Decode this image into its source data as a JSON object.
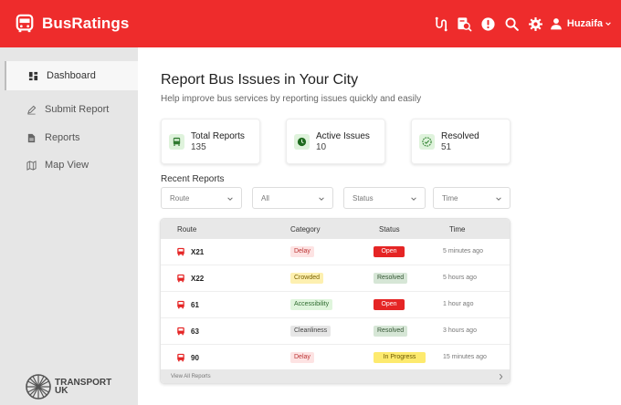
{
  "app": {
    "name": "BusRatings"
  },
  "header": {
    "user_name": "Huzaifa"
  },
  "sidebar": {
    "items": [
      {
        "label": "Dashboard",
        "active": true
      },
      {
        "label": "Submit Report",
        "active": false
      },
      {
        "label": "Reports",
        "active": false
      },
      {
        "label": "Map View",
        "active": false
      }
    ],
    "logo_text": [
      "TRANSPORT",
      "UK"
    ]
  },
  "main": {
    "title": "Report Bus Issues in Your City",
    "subtitle": "Help improve bus services by reporting issues quickly and easily",
    "stats": [
      {
        "label": "Total Reports",
        "value": "135",
        "icon": "bus-icon"
      },
      {
        "label": "Active Issues",
        "value": "10",
        "icon": "clock-icon"
      },
      {
        "label": "Resolved",
        "value": "51",
        "icon": "verified-icon"
      }
    ],
    "recent_title": "Recent Reports",
    "filters": [
      {
        "label": "Route"
      },
      {
        "label": "All"
      },
      {
        "label": "Status"
      },
      {
        "label": "Time"
      }
    ],
    "table": {
      "columns": [
        "Route",
        "Category",
        "Status",
        "Time"
      ],
      "rows": [
        {
          "route": "X21",
          "category": "Delay",
          "status": "Open",
          "time": "5 minutes ago"
        },
        {
          "route": "X22",
          "category": "Crowded",
          "status": "Resolved",
          "time": "5 hours ago"
        },
        {
          "route": "61",
          "category": "Accessibility",
          "status": "Open",
          "time": "1 hour ago"
        },
        {
          "route": "63",
          "category": "Cleanliness",
          "status": "Resolved",
          "time": "3 hours ago"
        },
        {
          "route": "90",
          "category": "Delay",
          "status": "In Progress",
          "time": "15 minutes ago"
        }
      ],
      "footer_link": "View All Reports"
    }
  },
  "colors": {
    "brand": "#ee2c2c",
    "delay_bg": "#fde3e3",
    "crowded_bg": "#fdf0b0",
    "accessibility_bg": "#dff5dc",
    "cleanliness_bg": "#e6e6e6",
    "open_bg": "#e52525",
    "resolved_bg": "#d6e6d6",
    "in_progress_bg": "#fdea6e"
  }
}
